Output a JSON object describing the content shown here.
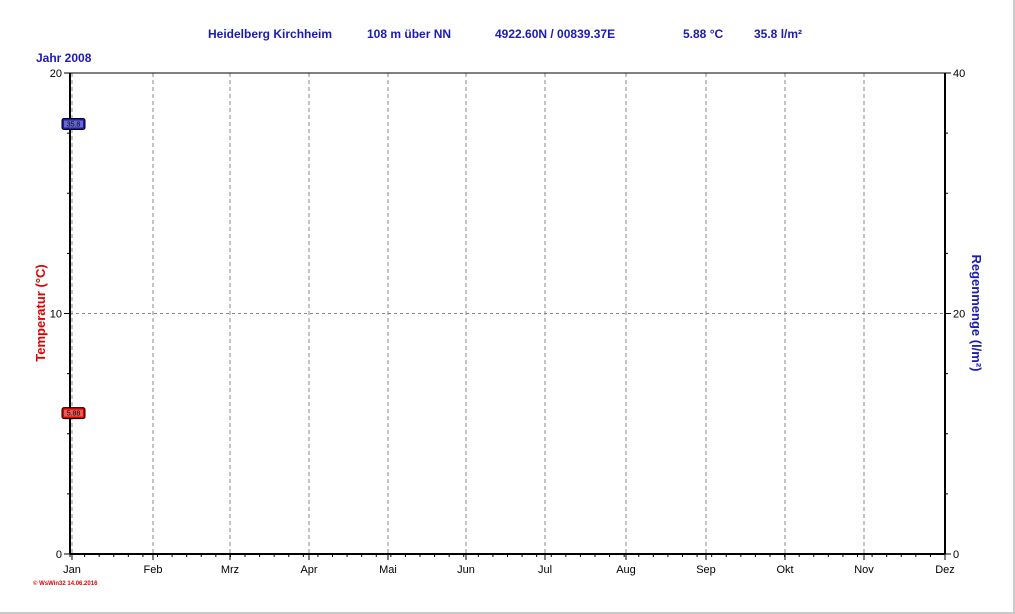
{
  "header": {
    "station": "Heidelberg Kirchheim",
    "elevation": "108 m über NN",
    "coordinates": "4922.60N / 00839.37E",
    "temperature": "5.88 °C",
    "rain": "35.8 l/m²"
  },
  "year_label": "Jahr  2008",
  "credit": "© WsWin32  14.06.2016",
  "colors": {
    "temperature": "#e00000",
    "rain": "#1a1ab4",
    "grid": "#888888",
    "axis": "#000000"
  },
  "chart_data": {
    "type": "line",
    "title": "Heidelberg Kirchheim     108 m über NN          4922.60N / 00839.37E               5.88 °C       35.8 l/m²",
    "x_categories": [
      "Jan",
      "Feb",
      "Mrz",
      "Apr",
      "Mai",
      "Jun",
      "Jul",
      "Aug",
      "Sep",
      "Okt",
      "Nov",
      "Dez"
    ],
    "y_left": {
      "label": "Temperatur  (°C)",
      "ylim": [
        0,
        20
      ],
      "ticks": [
        "0",
        "10",
        "20"
      ]
    },
    "y_right": {
      "label": "Regenmenge  (l/m²)",
      "ylim": [
        0,
        40
      ],
      "ticks": [
        "0",
        "20",
        "40"
      ]
    },
    "grid": true,
    "series": [
      {
        "axis": "left",
        "color": "#e00000",
        "marker_value": 5.88,
        "marker_label": "5.88"
      },
      {
        "axis": "right",
        "color": "#1a1ab4",
        "marker_value": 35.8,
        "marker_label": "35.8"
      }
    ]
  }
}
